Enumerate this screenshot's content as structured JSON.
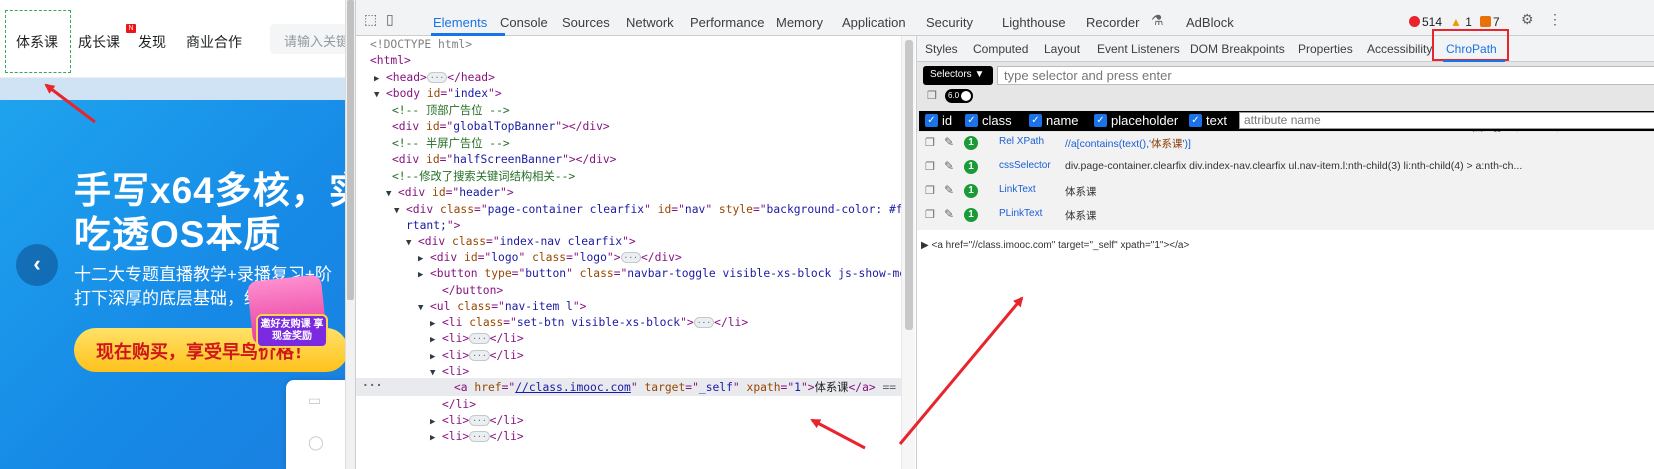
{
  "webpage": {
    "nav": [
      "体系课",
      "成长课",
      "发现",
      "商业合作"
    ],
    "nav_badge": "N",
    "search_placeholder": "请输入关键",
    "banner_title_1": "手写x64多核，实",
    "banner_title_2": "吃透OS本质",
    "banner_sub_1": "十二大专题直播教学+录播复习+阶",
    "banner_sub_2": "打下深厚的底层基础，结",
    "banner_cta": "现在购买，享受早鸟价格！",
    "gift_label": "邀好友购课 享现金奖励",
    "prev_arrow": "‹"
  },
  "devtools": {
    "tabs": [
      "Elements",
      "Console",
      "Sources",
      "Network",
      "Performance",
      "Memory",
      "Application",
      "Security",
      "Lighthouse",
      "Recorder",
      "AdBlock"
    ],
    "active_tab": "Elements",
    "errors": "514",
    "warnings": "1",
    "issues": "7",
    "colors": {
      "accent": "#1a73e8",
      "error": "#e8242c",
      "warning": "#f29900",
      "issue": "#e8710a"
    },
    "elements": {
      "lines": [
        {
          "indent": 0,
          "arrow": "",
          "html": "&lt;!DOCTYPE html&gt;",
          "kind": "doctype"
        },
        {
          "indent": 0,
          "arrow": "",
          "tag": "html"
        },
        {
          "indent": 1,
          "arrow": "▶",
          "tag": "head"
        },
        {
          "indent": 1,
          "arrow": "▼",
          "tag": "body"
        },
        {
          "indent": 2,
          "comment": " 顶部广告位 "
        },
        {
          "indent": 2,
          "tag": "div-globalTopBanner"
        },
        {
          "indent": 2,
          "comment": " 半屏广告位 "
        },
        {
          "indent": 2,
          "tag": "div-halfScreenBanner"
        },
        {
          "indent": 2,
          "comment": "修改了搜索关键词结构相关"
        }
      ],
      "selected_href": "//class.imooc.com",
      "selected_text": "体系课",
      "selected_suffix": "== $0"
    }
  },
  "side_pane": {
    "tabs": [
      "Styles",
      "Computed",
      "Layout",
      "Event Listeners",
      "DOM Breakpoints",
      "Properties",
      "Accessibility",
      "ChroPath"
    ],
    "active_tab": "ChroPath",
    "chropath": {
      "selector_type": "Selectors",
      "input_placeholder": "type selector and press enter",
      "version": "6.0",
      "checks": [
        "id",
        "class",
        "name",
        "placeholder",
        "text"
      ],
      "attr_placeholder": "attribute name",
      "results": [
        {
          "type": "Rel XPath",
          "count": "1",
          "value_pre": "//a[contains(text(),'",
          "value_hl": "体系课",
          "value_post": "')]"
        },
        {
          "type": "cssSelector",
          "count": "1",
          "value": "div.page-container.clearfix div.index-nav.clearfix ul.nav-item.l:nth-child(3) li:nth-child(4) > a:nth-ch..."
        },
        {
          "type": "LinkText",
          "count": "1",
          "value": "体系课"
        },
        {
          "type": "PLinkText",
          "count": "1",
          "value": "体系课"
        }
      ],
      "matched": "<a href=\"//class.imooc.com\" target=\"_self\" xpath=\"1\"></a>"
    }
  }
}
